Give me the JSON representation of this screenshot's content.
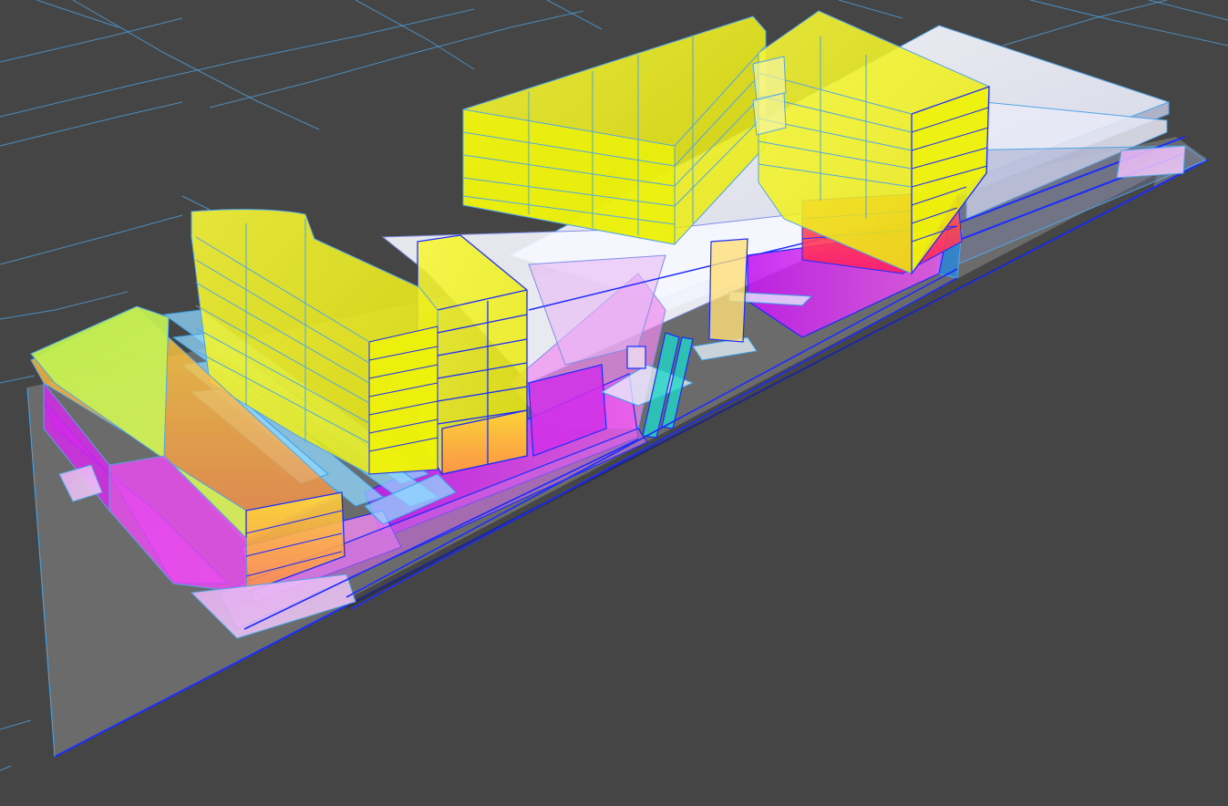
{
  "viewport": {
    "background": "#454545",
    "style": "xray-axonometric",
    "projection": "axonometric"
  },
  "colors": {
    "parcel_lines": "#4fa6e6",
    "edge": "#1a2cff",
    "office": "#f5f50a",
    "residential": "#b8f04a",
    "retail": "#f020f0",
    "hotel": "#ff2a6a",
    "transition": "#ff9a3c",
    "circulation": "#8fd8ff",
    "podium": "#f2f4ff",
    "site": "#8a8a8a"
  },
  "program_blocks": [
    {
      "id": "east-tower",
      "use": "office",
      "floors": 8
    },
    {
      "id": "central-bar",
      "use": "office",
      "floors": 5
    },
    {
      "id": "west-tower",
      "use": "office",
      "floors": 11
    },
    {
      "id": "corner-wing",
      "use": "office",
      "floors": 8
    },
    {
      "id": "residential-block",
      "use": "residential",
      "floors": 7
    },
    {
      "id": "retail-base",
      "use": "retail",
      "floors": 3
    },
    {
      "id": "hotel-levels",
      "use": "hotel",
      "floors": 4
    }
  ],
  "layers_visible": [
    "site",
    "podium",
    "retail",
    "office",
    "residential",
    "circulation"
  ]
}
